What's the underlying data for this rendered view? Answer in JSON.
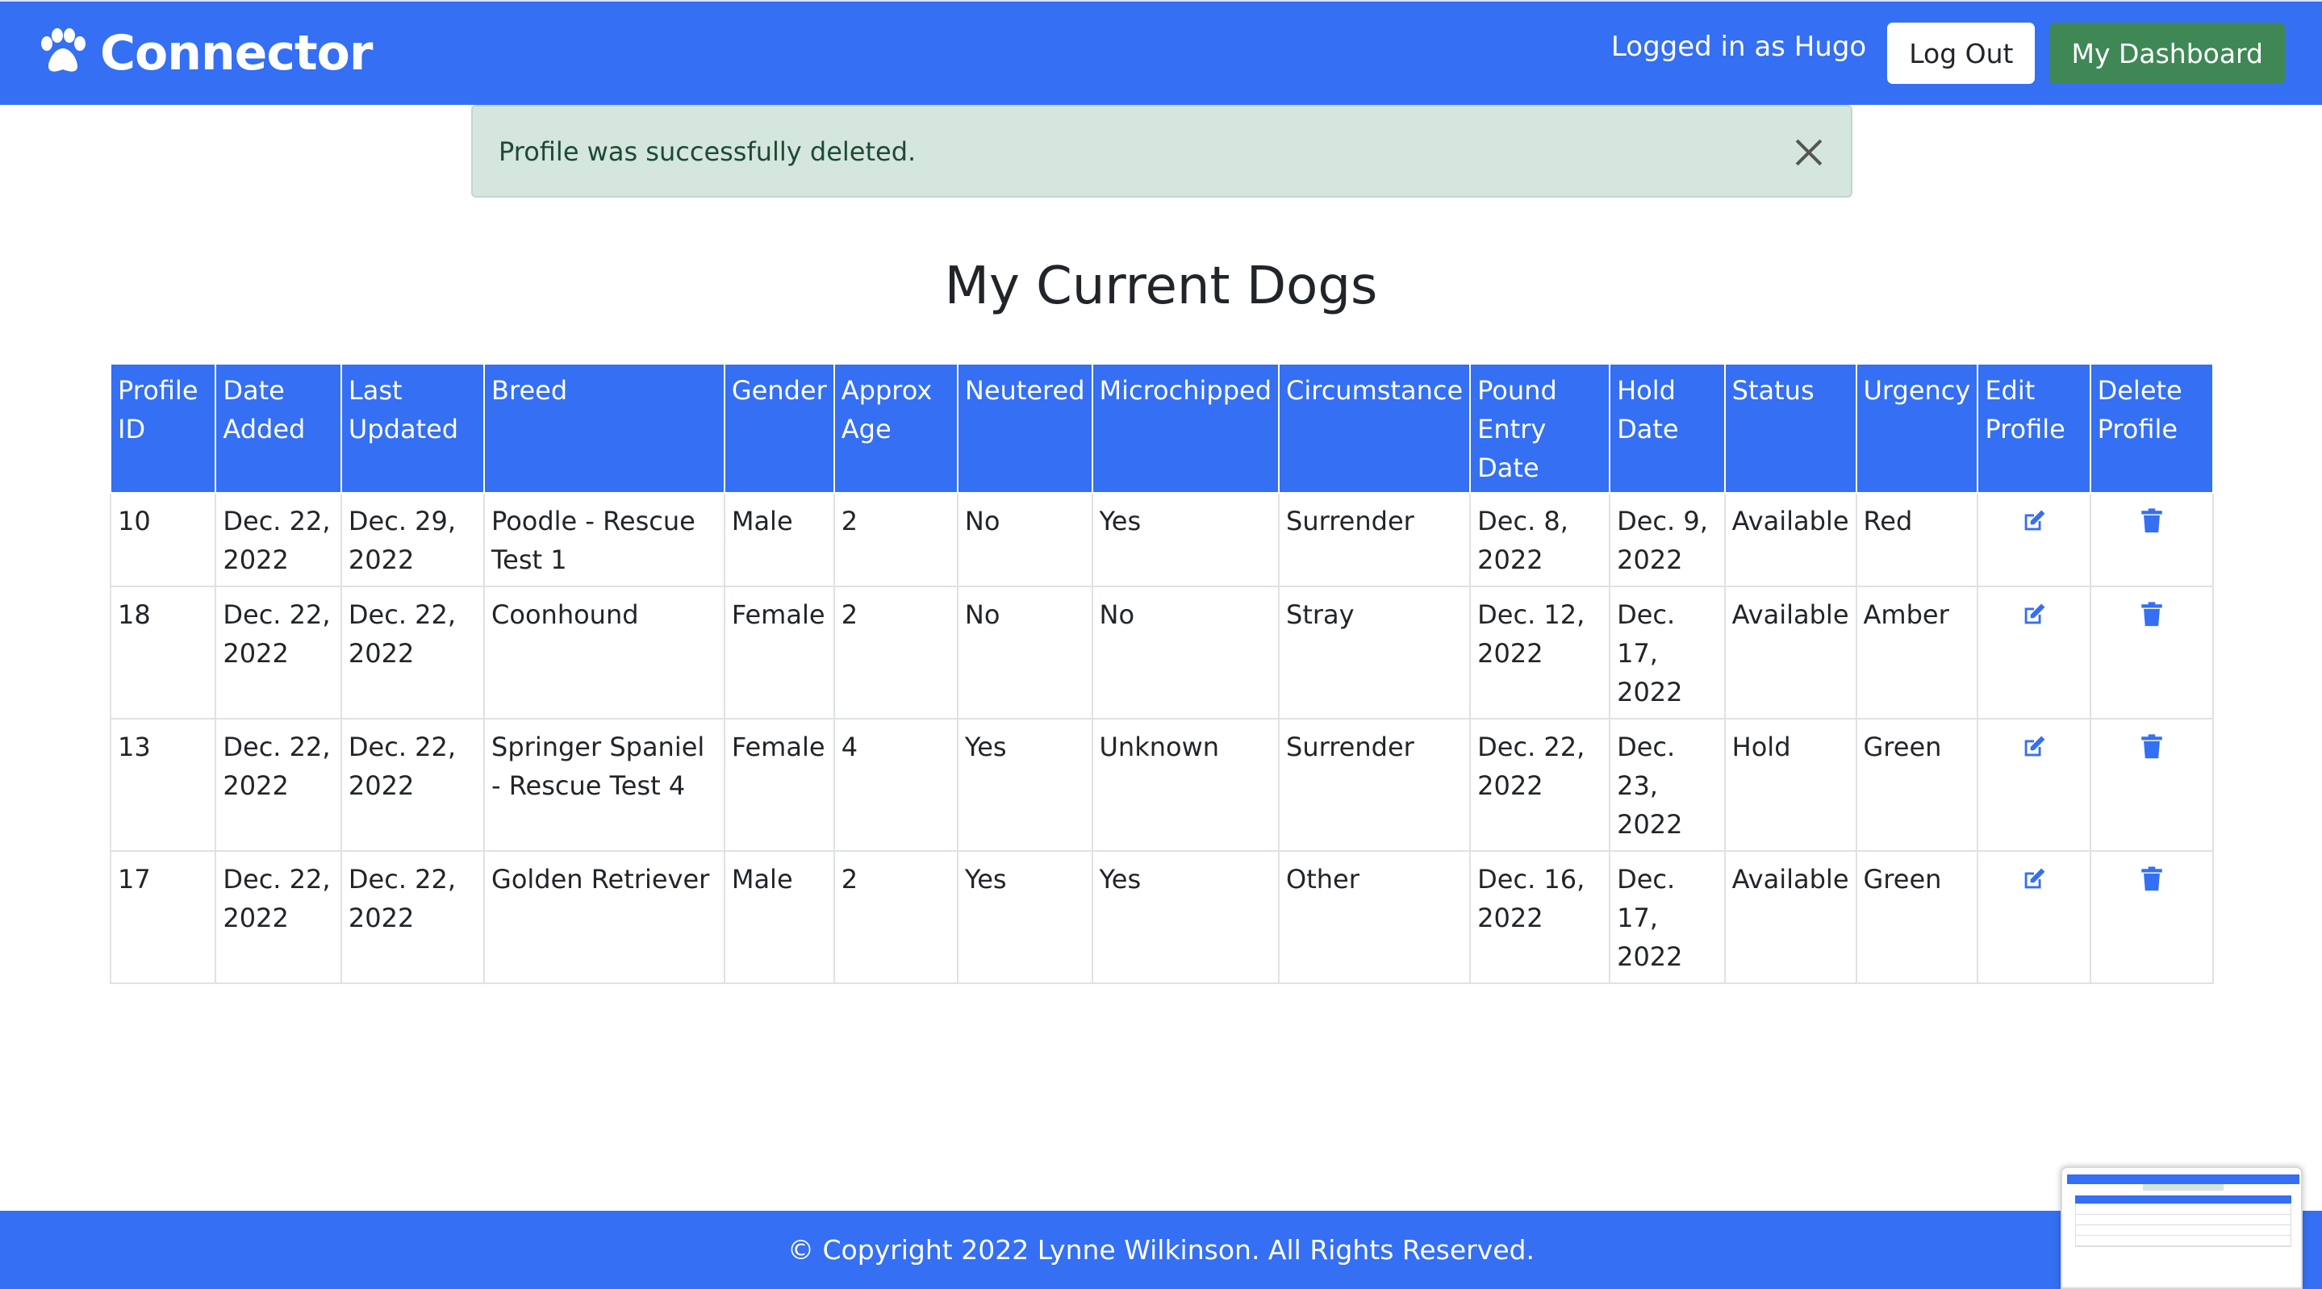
{
  "navbar": {
    "brand": "Connector",
    "brand_icon": "paw-icon",
    "logged_in_text": "Logged in as Hugo",
    "logout_label": "Log Out",
    "dashboard_label": "My Dashboard"
  },
  "alert": {
    "message": "Profile was successfully deleted."
  },
  "page": {
    "title": "My Current Dogs"
  },
  "table": {
    "headers": [
      "Profile ID",
      "Date Added",
      "Last Updated",
      "Breed",
      "Gender",
      "Approx Age",
      "Neutered",
      "Microchipped",
      "Circumstance",
      "Pound Entry Date",
      "Hold Date",
      "Status",
      "Urgency",
      "Edit Profile",
      "Delete Profile"
    ],
    "rows": [
      {
        "id": "10",
        "date_added": "Dec. 22, 2022",
        "last_updated": "Dec. 29, 2022",
        "breed": "Poodle - Rescue Test 1",
        "gender": "Male",
        "age": "2",
        "neutered": "No",
        "microchipped": "Yes",
        "circumstance": "Surrender",
        "pound_entry": "Dec. 8, 2022",
        "hold_date": "Dec. 9, 2022",
        "status": "Available",
        "urgency": "Red"
      },
      {
        "id": "18",
        "date_added": "Dec. 22, 2022",
        "last_updated": "Dec. 22, 2022",
        "breed": "Coonhound",
        "gender": "Female",
        "age": "2",
        "neutered": "No",
        "microchipped": "No",
        "circumstance": "Stray",
        "pound_entry": "Dec. 12, 2022",
        "hold_date": "Dec. 17, 2022",
        "status": "Available",
        "urgency": "Amber"
      },
      {
        "id": "13",
        "date_added": "Dec. 22, 2022",
        "last_updated": "Dec. 22, 2022",
        "breed": "Springer Spaniel - Rescue Test 4",
        "gender": "Female",
        "age": "4",
        "neutered": "Yes",
        "microchipped": "Unknown",
        "circumstance": "Surrender",
        "pound_entry": "Dec. 22, 2022",
        "hold_date": "Dec. 23, 2022",
        "status": "Hold",
        "urgency": "Green"
      },
      {
        "id": "17",
        "date_added": "Dec. 22, 2022",
        "last_updated": "Dec. 22, 2022",
        "breed": "Golden Retriever",
        "gender": "Male",
        "age": "2",
        "neutered": "Yes",
        "microchipped": "Yes",
        "circumstance": "Other",
        "pound_entry": "Dec. 16, 2022",
        "hold_date": "Dec. 17, 2022",
        "status": "Available",
        "urgency": "Green"
      }
    ],
    "edit_icon": "edit-icon",
    "delete_icon": "trash-icon"
  },
  "footer": {
    "copyright": "© Copyright 2022 Lynne Wilkinson. All Rights Reserved."
  },
  "colors": {
    "primary": "#346ff4",
    "dashboard_button": "#3f8856",
    "alert_bg": "#d4e6dd",
    "alert_text": "#1d4a35"
  }
}
